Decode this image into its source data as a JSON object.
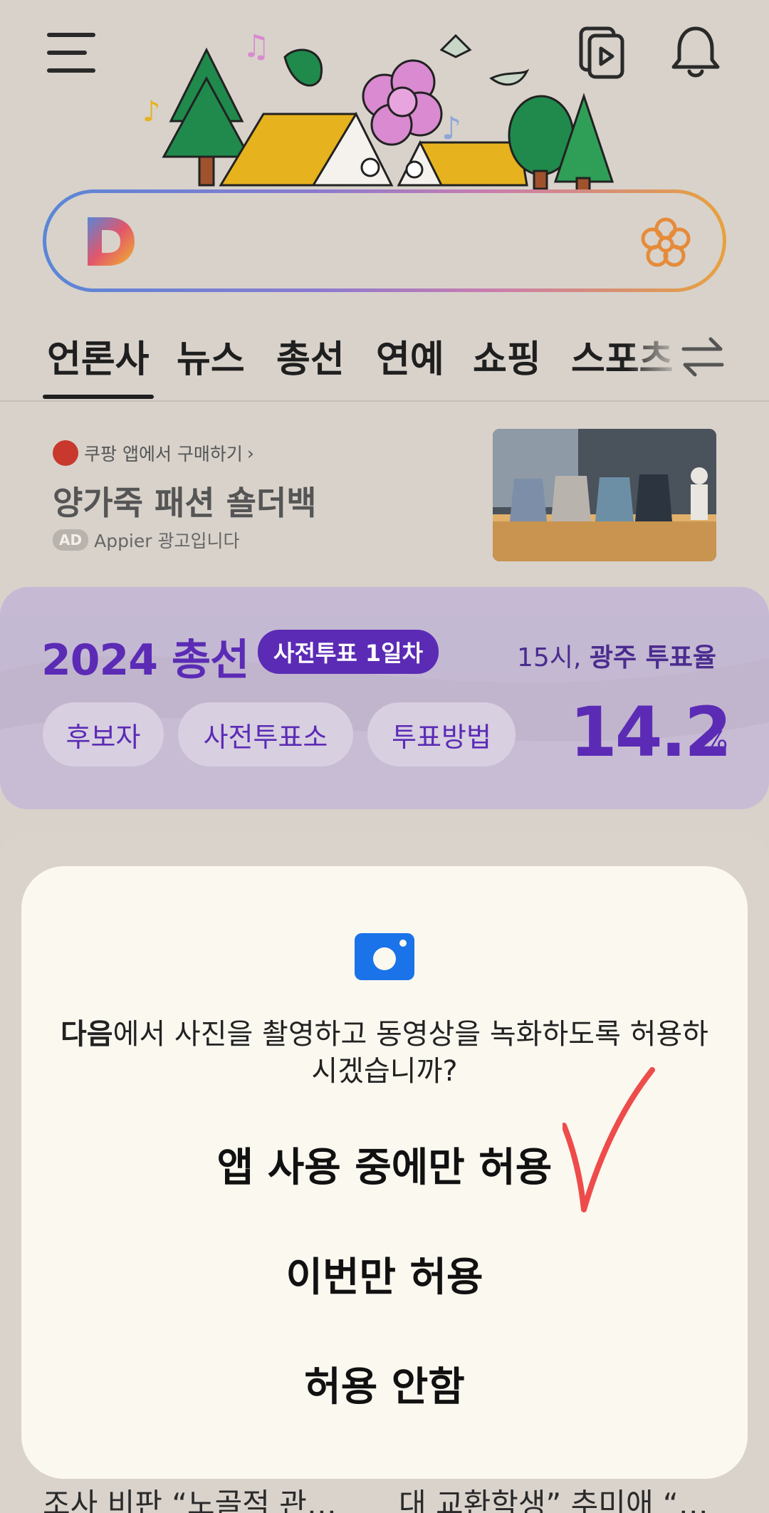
{
  "header": {
    "icons": [
      "menu-icon",
      "video-icon",
      "bell-icon",
      "daum-logo-icon",
      "flower-icon"
    ],
    "search": {
      "placeholder": ""
    }
  },
  "tabs": [
    {
      "label": "언론사",
      "active": true
    },
    {
      "label": "뉴스"
    },
    {
      "label": "총선"
    },
    {
      "label": "연예"
    },
    {
      "label": "쇼핑"
    },
    {
      "label": "스포츠"
    }
  ],
  "ad": {
    "source": "쿠팡 앱에서 구매하기",
    "source_chevron": "›",
    "title": "양가죽 패션 숄더백",
    "badge": "AD",
    "advertiser": "Appier 광고입니다"
  },
  "election": {
    "title": "2024 총선",
    "badge": "사전투표 1일차",
    "turnout_label_time": "15시,",
    "turnout_label_region": "광주 투표율",
    "chips": [
      "후보자",
      "사전투표소",
      "투표방법"
    ],
    "turnout_value": "14.2",
    "turnout_unit": "%"
  },
  "news_peek": {
    "left": "조사 비판 “노골적 관…",
    "right": "대 교환학생” 추미애 “…"
  },
  "dialog": {
    "app_name": "다음",
    "message_rest": "에서 사진을 촬영하고 동영상을 녹화하도록 허용하시겠습니까?",
    "allow_while_using": "앱 사용 중에만 허용",
    "allow_once": "이번만 허용",
    "deny": "허용 안함"
  },
  "colors": {
    "background": "#d8d2cb",
    "election_purple": "#5b2bb5",
    "dialog_bg": "#fbf8f0",
    "camera_blue": "#1a73e8",
    "annotation_red": "#ee4b4b"
  }
}
